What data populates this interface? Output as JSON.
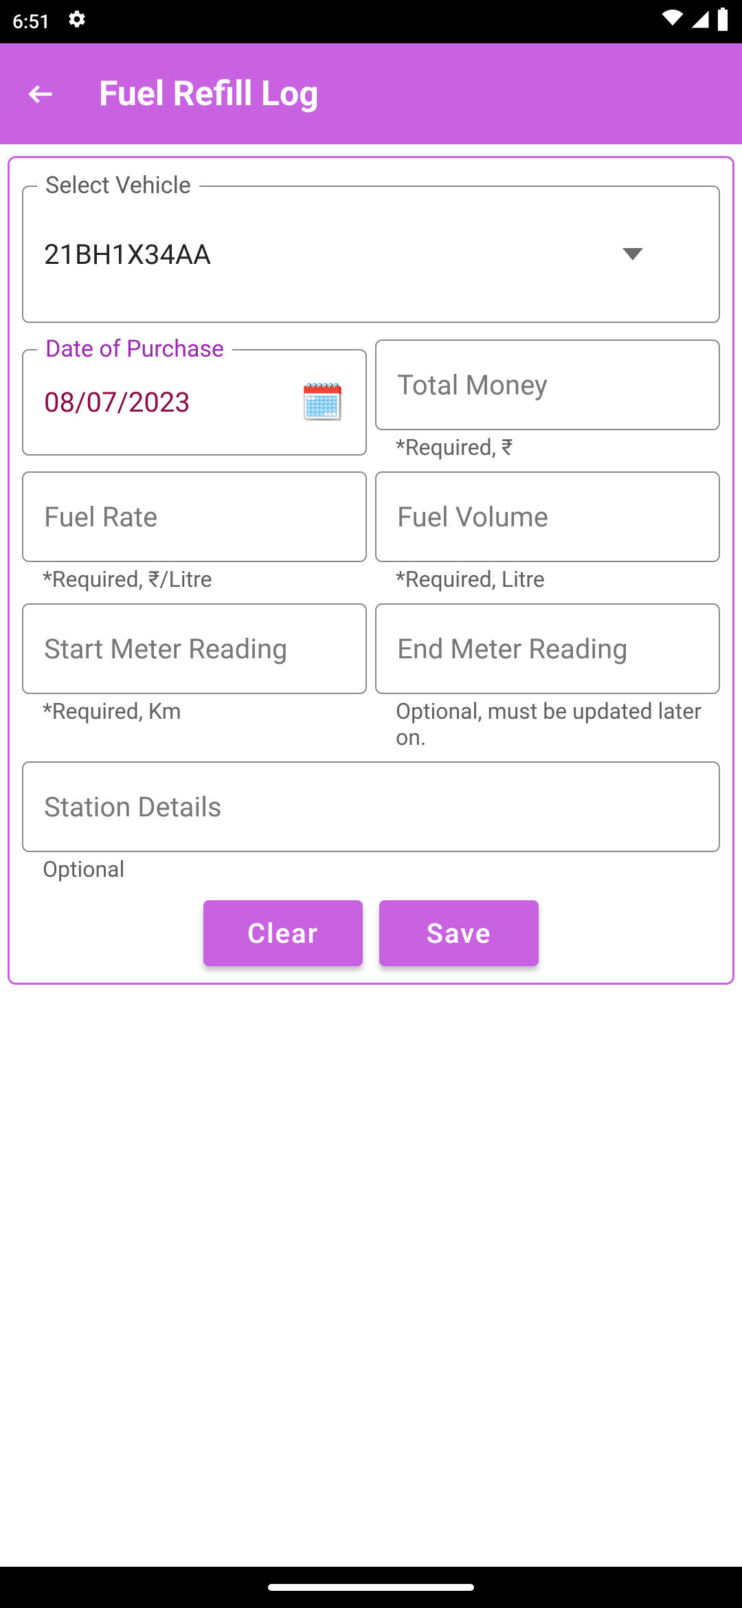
{
  "status": {
    "time": "6:51"
  },
  "appBar": {
    "title": "Fuel Refill Log"
  },
  "form": {
    "vehicle": {
      "label": "Select Vehicle",
      "value": "21BH1X34AA"
    },
    "date": {
      "label": "Date of Purchase",
      "value": "08/07/2023"
    },
    "totalMoney": {
      "placeholder": "Total Money",
      "helper": "*Required, ₹"
    },
    "fuelRate": {
      "placeholder": "Fuel Rate",
      "helper": "*Required, ₹/Litre"
    },
    "fuelVolume": {
      "placeholder": "Fuel Volume",
      "helper": "*Required, Litre"
    },
    "startMeter": {
      "placeholder": "Start Meter Reading",
      "helper": "*Required, Km"
    },
    "endMeter": {
      "placeholder": "End Meter Reading",
      "helper": "Optional, must be updated later on."
    },
    "station": {
      "placeholder": "Station Details",
      "helper": "Optional"
    }
  },
  "buttons": {
    "clear": "Clear",
    "save": "Save"
  }
}
